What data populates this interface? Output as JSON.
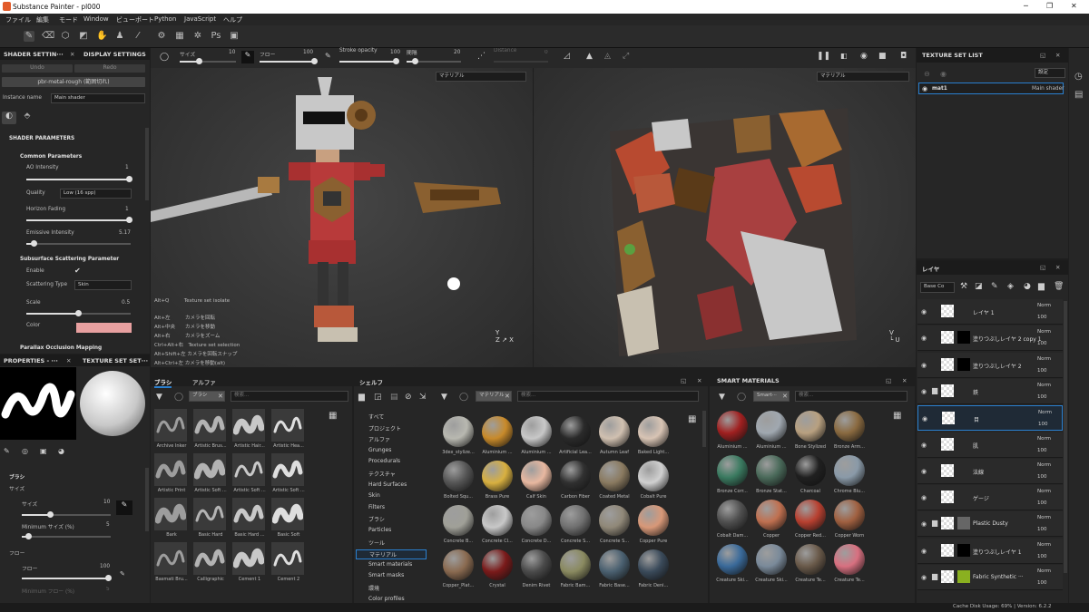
{
  "window": {
    "title": "Substance Painter - pl000"
  },
  "menu": [
    "ファイル",
    "編集",
    "モード",
    "Window",
    "ビューポート",
    "Python",
    "JavaScript",
    "ヘルプ"
  ],
  "toolbar": {
    "size_label": "サイズ",
    "size_value": "10",
    "flow_label": "フロー",
    "flow_value": "100",
    "stroke_label": "Stroke opacity",
    "stroke_value": "100",
    "spacing_label": "間隔",
    "spacing_value": "20",
    "distance_label": "Distance",
    "distance_value": "0"
  },
  "shader_tab": {
    "tab1": "SHADER SETTIN···",
    "tab2": "DISPLAY SETTINGS",
    "undo": "Undo",
    "redo": "Redo",
    "shader": "pbr-metal-rough (範囲切れ)",
    "instance_label": "Instance name",
    "instance_value": "Main shader",
    "params_title": "SHADER PARAMETERS",
    "common": "Common Parameters",
    "ao": "AO Intensity",
    "ao_val": "1",
    "quality": "Quality",
    "quality_val": "Low (16 spp)",
    "horizon": "Horizon Fading",
    "horizon_val": "1",
    "emissive": "Emissive Intensity",
    "emissive_val": "5.17",
    "sss": "Subsurface Scattering Parameter",
    "enable": "Enable",
    "scattering_type": "Scattering Type",
    "scattering_val": "Skin",
    "scale": "Scale",
    "scale_val": "0.5",
    "color": "Color",
    "color_hex": "#e8a0a0",
    "parallax": "Parallax Occlusion Mapping"
  },
  "properties": {
    "tab1": "PROPERTIES - ···",
    "tab2": "TEXTURE SET SET···",
    "brush": "ブラシ",
    "size": "サイズ",
    "size_label": "サイズ",
    "size_val": "10",
    "min_size": "Minimum サイズ (%)",
    "min_size_val": "5",
    "flow_section": "フロー",
    "flow": "フロー",
    "flow_val": "100",
    "min_flow": "Minimum フロー (%)",
    "min_flow_val": "5"
  },
  "viewport": {
    "dd1": "マテリアル",
    "dd2": "マテリアル",
    "hints": [
      "Alt+Q　　　Texture set isolate",
      "Alt+左　　　カメラを回転",
      "Alt+中央　　カメラを移動",
      "Alt+右　　　カメラをズーム",
      "Ctrl+Alt+右　Texture set selection",
      "Alt+Shift+左 カメラを回転スナップ",
      "Alt+Ctrl+左 カメラを移動(alt)"
    ]
  },
  "brushes": {
    "tab1": "ブラシ",
    "tab2": "アルファ",
    "filter": "ブラシ",
    "search": "検索...",
    "items": [
      "Archive Inker",
      "Artistic Brus...",
      "Artistic Hair...",
      "Artistic Hea...",
      "Artistic Print",
      "Artistic Soft ...",
      "Artistic Soft ...",
      "Artistic Soft ...",
      "Bark",
      "Basic Hard",
      "Basic Hard ...",
      "Basic Soft",
      "Basmati Bru...",
      "Calligraphic",
      "Cement 1",
      "Cement 2"
    ]
  },
  "shelf": {
    "title": "シェルフ",
    "filter": "マテリアル",
    "search": "検索...",
    "categories": [
      "すべて",
      "プロジェクト",
      "アルファ",
      "Grunges",
      "Procedurals",
      "テクスチャ",
      "Hard Surfaces",
      "Skin",
      "Filters",
      "ブラシ",
      "Particles",
      "ツール",
      "マテリアル",
      "Smart materials",
      "Smart masks",
      "環境",
      "Color profiles"
    ],
    "selected": "マテリアル",
    "items": [
      {
        "n": "3dex_stylize...",
        "c": "#b8b8b0"
      },
      {
        "n": "Aluminium ...",
        "c": "#c88a2a"
      },
      {
        "n": "Aluminium ...",
        "c": "#c8c8c8"
      },
      {
        "n": "Artificial Lea...",
        "c": "#2a2a2a"
      },
      {
        "n": "Autumn Leaf",
        "c": "#d0c0b0"
      },
      {
        "n": "Baked Light...",
        "c": "#d8c4b4"
      },
      {
        "n": "Bolted Squ...",
        "c": "#555"
      },
      {
        "n": "Brass Pure",
        "c": "#d8b040"
      },
      {
        "n": "Calf Skin",
        "c": "#e8b8a0"
      },
      {
        "n": "Carbon Fiber",
        "c": "#303030"
      },
      {
        "n": "Coated Metal",
        "c": "#8a7a60"
      },
      {
        "n": "Cobalt Pure",
        "c": "#d0d0d0"
      },
      {
        "n": "Concrete B...",
        "c": "#a0a098"
      },
      {
        "n": "Concrete Cl...",
        "c": "#c8c8c8"
      },
      {
        "n": "Concrete D...",
        "c": "#888"
      },
      {
        "n": "Concrete S...",
        "c": "#707070"
      },
      {
        "n": "Concrete S...",
        "c": "#908878"
      },
      {
        "n": "Copper Pure",
        "c": "#d89878"
      },
      {
        "n": "Copper_Plat...",
        "c": "#8a6a50"
      },
      {
        "n": "Crystal",
        "c": "#7a1a1a"
      },
      {
        "n": "Denim Rivet",
        "c": "#4a4a4a"
      },
      {
        "n": "Fabric Bam...",
        "c": "#8a8a60"
      },
      {
        "n": "Fabric Base...",
        "c": "#4a6070"
      },
      {
        "n": "Fabric Deni...",
        "c": "#3a4a5a"
      }
    ]
  },
  "smart": {
    "title": "SMART MATERIALS",
    "filter": "Smart···",
    "search": "検索...",
    "items": [
      {
        "n": "Aluminium ...",
        "c": "#a02020"
      },
      {
        "n": "Aluminium ...",
        "c": "#a0a8b0"
      },
      {
        "n": "Bone Stylized",
        "c": "#b8a080"
      },
      {
        "n": "Bronze Arm...",
        "c": "#8a6a40"
      },
      {
        "n": "Bronze Corr...",
        "c": "#3a7a60"
      },
      {
        "n": "Bronze Stat...",
        "c": "#4a6a5a"
      },
      {
        "n": "Charcoal",
        "c": "#202020"
      },
      {
        "n": "Chrome Blu...",
        "c": "#8a9aa8"
      },
      {
        "n": "Cobalt Dam...",
        "c": "#505050"
      },
      {
        "n": "Copper",
        "c": "#c07050"
      },
      {
        "n": "Copper Red...",
        "c": "#b84030"
      },
      {
        "n": "Copper Worn",
        "c": "#a06040"
      },
      {
        "n": "Creature Ski...",
        "c": "#3a6a9a"
      },
      {
        "n": "Creature Ski...",
        "c": "#7a8a9a"
      },
      {
        "n": "Creature Te...",
        "c": "#6a5a4a"
      },
      {
        "n": "Creature Te...",
        "c": "#d87080"
      }
    ]
  },
  "texture_set": {
    "title": "TEXTURE SET LIST",
    "settings": "設定",
    "mat": "mat1",
    "shader": "Main shader"
  },
  "layers": {
    "title": "レイヤ",
    "channel": "Base Co",
    "items": [
      {
        "n": "レイヤ 1",
        "b": "Norm",
        "o": "100"
      },
      {
        "n": "塗りつぶしレイヤ 2 copy 1",
        "b": "Norm",
        "o": "100"
      },
      {
        "n": "塗りつぶしレイヤ 2",
        "b": "Norm",
        "o": "100"
      },
      {
        "n": "鉄",
        "b": "Norm",
        "o": "100"
      },
      {
        "n": "目",
        "b": "Norm",
        "o": "100"
      },
      {
        "n": "肌",
        "b": "Norm",
        "o": "100"
      },
      {
        "n": "法線",
        "b": "Norm",
        "o": "100"
      },
      {
        "n": "ゲージ",
        "b": "Norm",
        "o": "100"
      },
      {
        "n": "Plastic Dusty",
        "b": "Norm",
        "o": "100"
      },
      {
        "n": "塗りつぶしレイヤ 1",
        "b": "Norm",
        "o": "100"
      },
      {
        "n": "Fabric Synthetic ···",
        "b": "Norm",
        "o": "100"
      }
    ]
  },
  "status": {
    "text": "Cache Disk Usage:  69% | Version: 6.2.2"
  }
}
